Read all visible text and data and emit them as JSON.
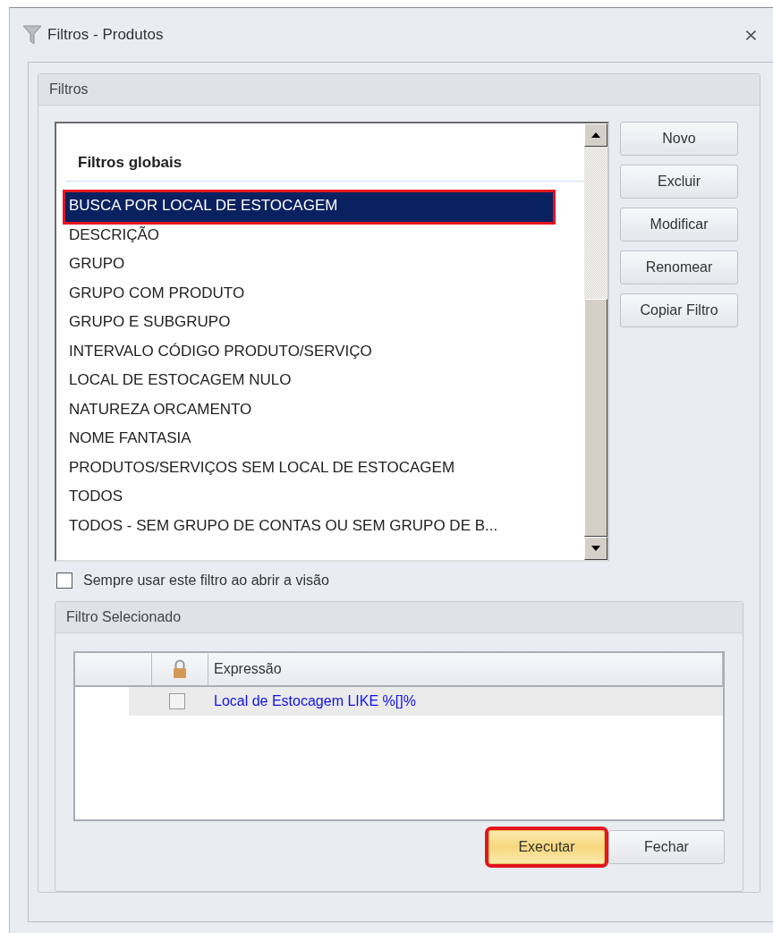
{
  "window": {
    "title": "Filtros - Produtos",
    "close": "⨯"
  },
  "filters_group": {
    "title": "Filtros"
  },
  "filter_list": {
    "section": "Filtros globais",
    "items": [
      {
        "label": "BUSCA POR LOCAL DE ESTOCAGEM",
        "selected": true,
        "highlighted": true
      },
      {
        "label": "DESCRIÇÃO",
        "selected": false,
        "highlighted": false
      },
      {
        "label": "GRUPO",
        "selected": false,
        "highlighted": false
      },
      {
        "label": "GRUPO COM PRODUTO",
        "selected": false,
        "highlighted": false
      },
      {
        "label": "GRUPO E SUBGRUPO",
        "selected": false,
        "highlighted": false
      },
      {
        "label": "INTERVALO CÓDIGO PRODUTO/SERVIÇO",
        "selected": false,
        "highlighted": false
      },
      {
        "label": "LOCAL DE ESTOCAGEM NULO",
        "selected": false,
        "highlighted": false
      },
      {
        "label": "NATUREZA ORCAMENTO",
        "selected": false,
        "highlighted": false
      },
      {
        "label": "NOME FANTASIA",
        "selected": false,
        "highlighted": false
      },
      {
        "label": "PRODUTOS/SERVIÇOS SEM LOCAL DE ESTOCAGEM",
        "selected": false,
        "highlighted": false
      },
      {
        "label": "TODOS",
        "selected": false,
        "highlighted": false
      },
      {
        "label": "TODOS - SEM GRUPO DE CONTAS OU SEM GRUPO DE B...",
        "selected": false,
        "highlighted": false
      }
    ]
  },
  "side_buttons": [
    "Novo",
    "Excluir",
    "Modificar",
    "Renomear",
    "Copiar Filtro"
  ],
  "always_use": {
    "label": "Sempre usar este filtro ao abrir a visão",
    "checked": false
  },
  "selected_filter": {
    "title": "Filtro Selecionado",
    "columns": [
      "Expressão"
    ],
    "rows": [
      {
        "checked": false,
        "expression": "Local de Estocagem LIKE %[]%"
      }
    ]
  },
  "bottom_buttons": [
    {
      "label": "Executar",
      "kind": "primary",
      "highlighted": true
    },
    {
      "label": "Fechar",
      "kind": "normal",
      "highlighted": false
    }
  ]
}
